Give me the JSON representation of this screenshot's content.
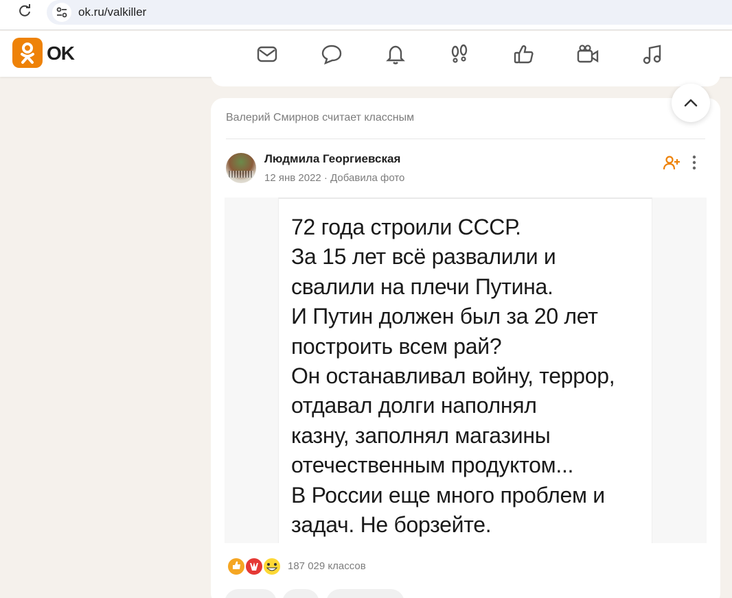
{
  "browser": {
    "url": "ok.ru/valkiller"
  },
  "header": {
    "logo_text": "OK",
    "nav_icons": [
      "messages-icon",
      "discussions-icon",
      "notifications-icon",
      "guests-icon",
      "events-icon",
      "video-icon",
      "music-icon"
    ]
  },
  "feed": {
    "card": {
      "who_liked": "Валерий Смирнов считает классным",
      "author": "Людмила Георгиевская",
      "date": "12 янв 2022",
      "action": "Добавила фото",
      "meta_separator": " · ",
      "photo_lines": [
        "72 года строили СССР.",
        "За 15 лет всё развалили и",
        "свалили на плечи Путина.",
        "И Путин должен был за 20 лет",
        "построить всем рай?",
        "Он останавливал войну, террор,",
        "отдавал долги наполнял",
        "казну, заполнял магазины",
        "отечественным продуктом...",
        "В России еще много проблем и",
        "задач. Не борзейте."
      ],
      "reactions_count": "187 029 классов"
    }
  },
  "colors": {
    "brand": "#ee8208",
    "background": "#f5f1ec"
  }
}
